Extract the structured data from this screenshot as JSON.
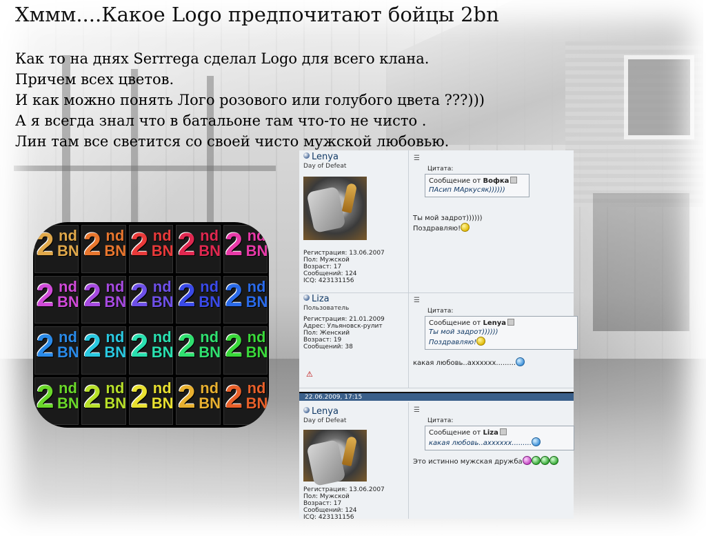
{
  "title": "Хммм....Какое Logo предпочитают бойцы 2bn",
  "text_lines": [
    "Как то на днях Serrrega сделал Logo для всего клана.",
    "Причем всех цветов.",
    "И как можно понять Лого розового или голубого цвета ???)))",
    "А я всегда знал что в батальоне там что-то не чисто .",
    "Лин там все светится со своей чисто мужской любовью."
  ],
  "logo_grid": {
    "big": "2",
    "sup": "nd",
    "sub": "BN",
    "colors": [
      "#e0a84a",
      "#e8762e",
      "#e83a3a",
      "#e02850",
      "#e83aa8",
      "#d04ad8",
      "#a64ae0",
      "#6e50e8",
      "#3a4ae8",
      "#2a6ae8",
      "#2a8ae8",
      "#2ac8e0",
      "#2ae0b0",
      "#30e070",
      "#3ad83a",
      "#6ad82a",
      "#b8e02a",
      "#e8e030",
      "#e8b030",
      "#e8602a"
    ]
  },
  "forum": {
    "posts": [
      {
        "username": "Lenya",
        "rank": "Day of Defeat",
        "info": [
          "Регистрация: 13.06.2007",
          "Пол: Мужской",
          "Возраст: 17",
          "Сообщений: 124",
          "ICQ: 423131156"
        ],
        "quote_label": "Цитата:",
        "quote_from_prefix": "Сообщение от ",
        "quote_from_name": "Вофка",
        "quote_lines": [
          "ПАсип МАркусяк))))))"
        ],
        "body_lines": [
          "Ты мой задрот))))))",
          "Поздравляю!"
        ]
      },
      {
        "username": "Liza",
        "rank": "Пользователь",
        "info": [
          "Регистрация: 21.01.2009",
          "Адрес: Ульяновск-рулит",
          "Пол: Женский",
          "Возраст: 19",
          "Сообщений: 38"
        ],
        "quote_label": "Цитата:",
        "quote_from_prefix": "Сообщение от ",
        "quote_from_name": "Lenya",
        "quote_lines": [
          "Ты мой задрот))))))",
          "Поздравляю!"
        ],
        "body_lines": [
          "какая любовь..ахххххх........."
        ]
      },
      {
        "date": "22.06.2009, 17:15",
        "username": "Lenya",
        "rank": "Day of Defeat",
        "info": [
          "Регистрация: 13.06.2007",
          "Пол: Мужской",
          "Возраст: 17",
          "Сообщений: 124",
          "ICQ: 423131156"
        ],
        "quote_label": "Цитата:",
        "quote_from_prefix": "Сообщение от ",
        "quote_from_name": "Liza",
        "quote_lines": [
          "какая любовь..ахххххх........."
        ],
        "body_lines": [
          "Это истинно мужская дружба"
        ]
      }
    ]
  }
}
